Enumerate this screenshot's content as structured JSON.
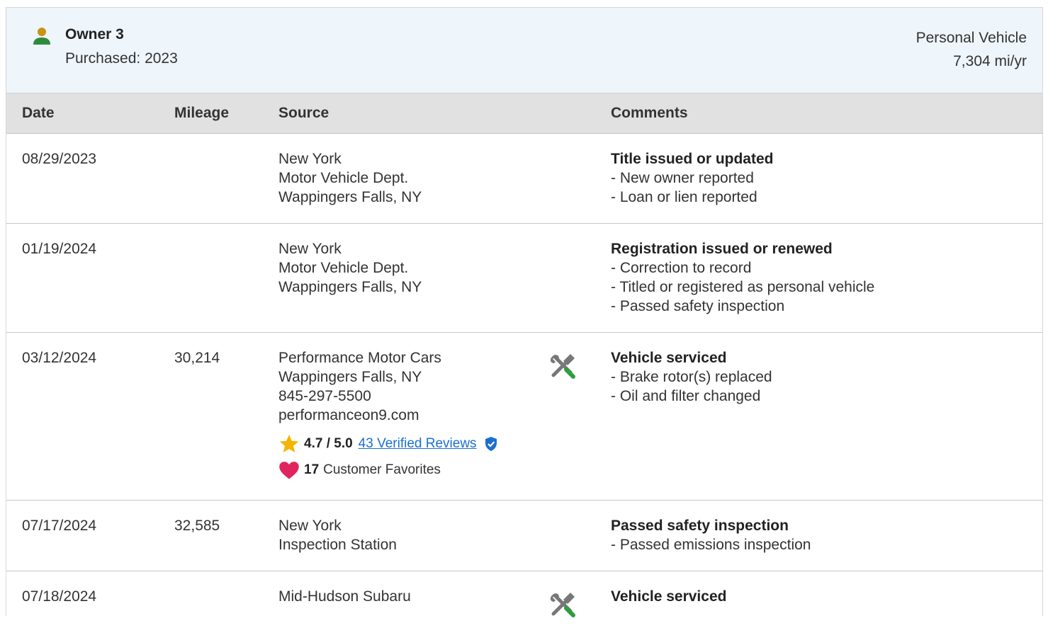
{
  "owner": {
    "title": "Owner 3",
    "purchased": "Purchased: 2023",
    "usage": "Personal Vehicle",
    "miles_per_year": "7,304 mi/yr",
    "icon": "person-icon",
    "icon_color_head": "#c8930e",
    "icon_color_body": "#2e8b3d"
  },
  "columns": {
    "date": "Date",
    "mileage": "Mileage",
    "source": "Source",
    "comments": "Comments"
  },
  "rows": [
    {
      "date": "08/29/2023",
      "mileage": "",
      "source": [
        "New York",
        "Motor Vehicle Dept.",
        "Wappingers Falls, NY"
      ],
      "comment_title": "Title issued or updated",
      "comment_items": [
        "New owner reported",
        "Loan or lien reported"
      ]
    },
    {
      "date": "01/19/2024",
      "mileage": "",
      "source": [
        "New York",
        "Motor Vehicle Dept.",
        "Wappingers Falls, NY"
      ],
      "comment_title": "Registration issued or renewed",
      "comment_items": [
        "Correction to record",
        "Titled or registered as personal vehicle",
        "Passed safety inspection"
      ]
    },
    {
      "date": "03/12/2024",
      "mileage": "30,214",
      "source": [
        "Performance Motor Cars",
        "Wappingers Falls, NY",
        "845-297-5500",
        "performanceon9.com"
      ],
      "icon": "service-tools-icon",
      "rating": {
        "score": "4.7 / 5.0",
        "reviews_link": "43 Verified Reviews",
        "favorites_count": "17",
        "favorites_label": "Customer Favorites",
        "star_color": "#f5b400",
        "heart_color": "#e0245e",
        "shield_color": "#1a6fd1"
      },
      "comment_title": "Vehicle serviced",
      "comment_items": [
        "Brake rotor(s) replaced",
        "Oil and filter changed"
      ]
    },
    {
      "date": "07/17/2024",
      "mileage": "32,585",
      "source": [
        "New York",
        "Inspection Station"
      ],
      "comment_title": "Passed safety inspection",
      "comment_items": [
        "Passed emissions inspection"
      ]
    },
    {
      "date": "07/18/2024",
      "mileage": "",
      "source": [
        "Mid-Hudson Subaru"
      ],
      "icon": "service-tools-icon",
      "comment_title": "Vehicle serviced",
      "comment_items": []
    }
  ]
}
